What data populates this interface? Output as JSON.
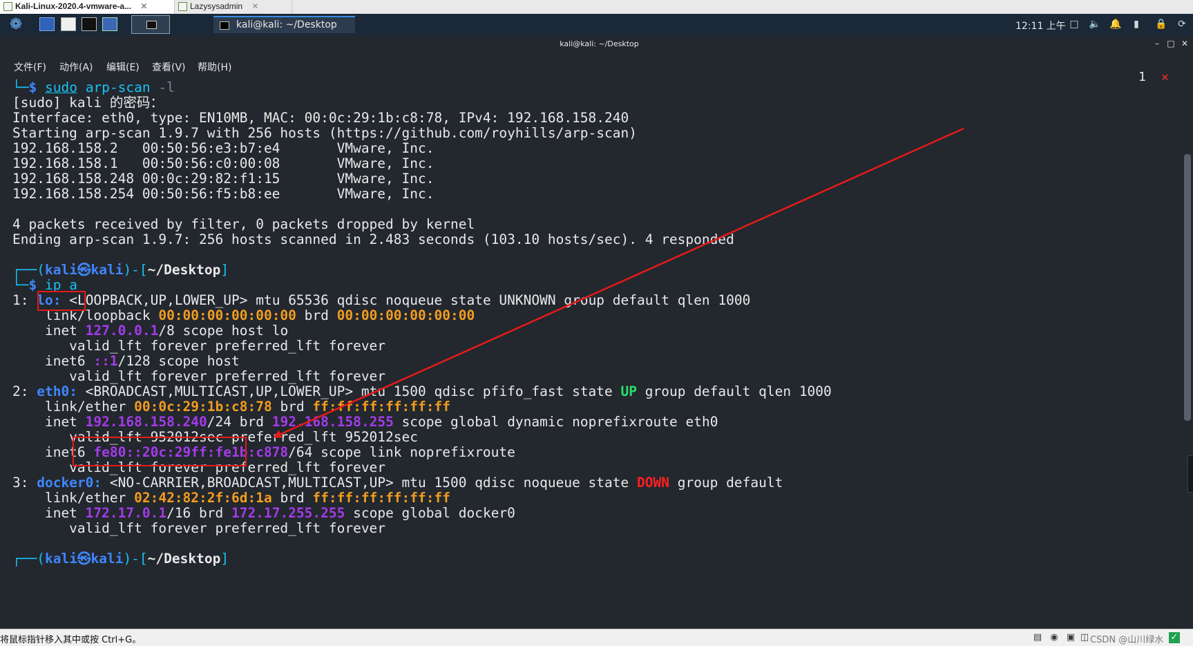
{
  "host_tabs": [
    {
      "label": "Kali-Linux-2020.4-vmware-a...",
      "active": true
    },
    {
      "label": "Lazysysadmin",
      "active": false
    }
  ],
  "host_tab_close": "✕",
  "panel": {
    "task_label": "kali@kali: ~/Desktop",
    "clock": "12:11 上午"
  },
  "window": {
    "title": "kali@kali: ~/Desktop",
    "controls": [
      "–",
      "□",
      "✕"
    ]
  },
  "menu": [
    "文件(F)",
    "动作(A)",
    "编辑(E)",
    "查看(V)",
    "帮助(H)"
  ],
  "terminal": {
    "exit_code": "1",
    "exit_mark": "✕",
    "prompt": {
      "user": "kali",
      "host": "kali",
      "at": "㉿",
      "dir": "~/Desktop",
      "open": "(",
      "close": ")-[",
      "end": "]"
    },
    "cmd1": {
      "sudo": "sudo",
      "rest": "arp-scan",
      "flag": "-l"
    },
    "lines_scan": [
      "[sudo] kali 的密码：",
      "Interface: eth0, type: EN10MB, MAC: 00:0c:29:1b:c8:78, IPv4: 192.168.158.240",
      "Starting arp-scan 1.9.7 with 256 hosts (https://github.com/royhills/arp-scan)",
      "192.168.158.2   00:50:56:e3:b7:e4       VMware, Inc.",
      "192.168.158.1   00:50:56:c0:00:08       VMware, Inc.",
      "192.168.158.248 00:0c:29:82:f1:15       VMware, Inc.",
      "192.168.158.254 00:50:56:f5:b8:ee       VMware, Inc.",
      "",
      "4 packets received by filter, 0 packets dropped by kernel",
      "Ending arp-scan 1.9.7: 256 hosts scanned in 2.483 seconds (103.10 hosts/sec). 4 responded"
    ],
    "cmd2": "ip a",
    "lo": {
      "idx": "1: ",
      "name": "lo:",
      "flags": " <LOOPBACK,UP,LOWER_UP> mtu 65536 qdisc noqueue state UNKNOWN group default qlen 1000",
      "link_pre": "    link/loopback ",
      "mac": "00:00:00:00:00:00",
      "brd": " brd ",
      "brd_mac": "00:00:00:00:00:00",
      "inet_pre": "    inet ",
      "inet": "127.0.0.1",
      "inet_post": "/8 scope host lo",
      "lft1": "       valid_lft forever preferred_lft forever",
      "inet6_pre": "    inet6 ",
      "inet6": "::1",
      "inet6_post": "/128 scope host",
      "lft2": "       valid_lft forever preferred_lft forever"
    },
    "eth0": {
      "idx": "2: ",
      "name": "eth0:",
      "flags_a": " <BROADCAST,MULTICAST,UP,LOWER_UP> mtu 1500 qdisc pfifo_fast state ",
      "state": "UP",
      "flags_b": " group default qlen 1000",
      "link_pre": "    link/ether ",
      "mac": "00:0c:29:1b:c8:78",
      "brd": " brd ",
      "brd_mac": "ff:ff:ff:ff:ff:ff",
      "inet_pre": "    inet ",
      "inet": "192.168.158.240",
      "inet_mask": "/24",
      "brd2": " brd ",
      "inet_brd": "192.168.158.255",
      "inet_post": " scope global dynamic noprefixroute eth0",
      "lft1": "       valid_lft 952012sec preferred_lft 952012sec",
      "inet6_pre": "    inet6 ",
      "inet6": "fe80::20c:29ff:fe1b:c878",
      "inet6_post": "/64 scope link noprefixroute",
      "lft2": "       valid_lft forever preferred_lft forever"
    },
    "docker0": {
      "idx": "3: ",
      "name": "docker0:",
      "flags_a": " <NO-CARRIER,BROADCAST,MULTICAST,UP> mtu 1500 qdisc noqueue state ",
      "state": "DOWN",
      "flags_b": " group default",
      "link_pre": "    link/ether ",
      "mac": "02:42:82:2f:6d:1a",
      "brd": " brd ",
      "brd_mac": "ff:ff:ff:ff:ff:ff",
      "inet_pre": "    inet ",
      "inet": "172.17.0.1",
      "inet_post1": "/16 brd ",
      "inet_brd": "172.17.255.255",
      "inet_post2": " scope global docker0",
      "lft1": "       valid_lft forever preferred_lft forever"
    }
  },
  "statusbar": {
    "text": "将鼠标指针移入其中或按 Ctrl+G。",
    "watermark": "CSDN @山川绿水"
  },
  "colors": {
    "terminal_bg": "#23272e",
    "prompt_blue": "#3f87ff",
    "mac_orange": "#f29d1e",
    "ip_purple": "#a43bea",
    "state_up": "#28e06a",
    "state_down": "#ff1f1f",
    "annotation_red": "#e81a1a"
  }
}
